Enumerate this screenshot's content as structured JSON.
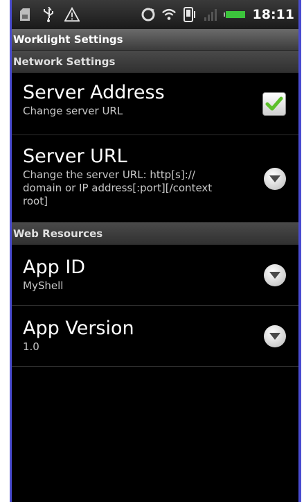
{
  "status_bar": {
    "time": "18:11",
    "left_icons": [
      "sd-card-icon",
      "usb-icon",
      "warning-icon"
    ],
    "right_icons": [
      "sync-icon",
      "wifi-icon",
      "phone-icon",
      "signal-icon",
      "battery-icon"
    ],
    "battery_color": "#3cc43c"
  },
  "app": {
    "title": "Worklight Settings"
  },
  "sections": {
    "network": {
      "header": "Network Settings",
      "server_address": {
        "title": "Server Address",
        "summary": "Change server URL",
        "checked": true
      },
      "server_url": {
        "title": "Server URL",
        "summary": "Change the server URL: http[s]://\ndomain or IP address[:port][/context\nroot]"
      }
    },
    "web": {
      "header": "Web Resources",
      "app_id": {
        "title": "App ID",
        "summary": "MyShell"
      },
      "app_version": {
        "title": "App Version",
        "summary": "1.0"
      }
    }
  },
  "colors": {
    "check_green": "#5cc02a",
    "frame_border": "#4a4cd0"
  }
}
